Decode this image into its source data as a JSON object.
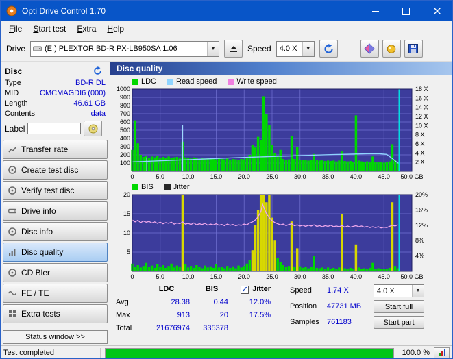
{
  "window": {
    "title": "Opti Drive Control 1.70"
  },
  "menu": {
    "items": [
      {
        "label": "File"
      },
      {
        "label": "Start test"
      },
      {
        "label": "Extra"
      },
      {
        "label": "Help"
      }
    ]
  },
  "toolbar": {
    "drive_label": "Drive",
    "drive_value": "(E:)   PLEXTOR BD-R  PX-LB950SA 1.06",
    "speed_label": "Speed",
    "speed_value": "4.0 X"
  },
  "sidebar": {
    "section_title": "Disc",
    "info": [
      {
        "label": "Type",
        "value": "BD-R DL"
      },
      {
        "label": "MID",
        "value": "CMCMAGDI6 (000)"
      },
      {
        "label": "Length",
        "value": "46.61 GB"
      },
      {
        "label": "Contents",
        "value": "data"
      }
    ],
    "label_label": "Label",
    "label_value": "",
    "buttons": [
      {
        "label": "Transfer rate"
      },
      {
        "label": "Create test disc"
      },
      {
        "label": "Verify test disc"
      },
      {
        "label": "Drive info"
      },
      {
        "label": "Disc info"
      },
      {
        "label": "Disc quality",
        "active": true
      },
      {
        "label": "CD Bler"
      },
      {
        "label": "FE / TE"
      },
      {
        "label": "Extra tests"
      }
    ],
    "status_window_button": "Status window >>"
  },
  "panel": {
    "title": "Disc quality",
    "stats": {
      "ldc_header": "LDC",
      "bis_header": "BIS",
      "jitter_label": "Jitter",
      "jitter_checked": true,
      "rows": [
        {
          "label": "Avg",
          "ldc": "28.38",
          "bis": "0.44",
          "jitter": "12.0%"
        },
        {
          "label": "Max",
          "ldc": "913",
          "bis": "20",
          "jitter": "17.5%"
        },
        {
          "label": "Total",
          "ldc": "21676974",
          "bis": "335378",
          "jitter": ""
        }
      ],
      "speed_label": "Speed",
      "speed_value": "1.74 X",
      "speed_select_value": "4.0 X",
      "position_label": "Position",
      "position_value": "47731 MB",
      "samples_label": "Samples",
      "samples_value": "761183",
      "start_full_label": "Start full",
      "start_part_label": "Start part"
    }
  },
  "statusbar": {
    "text": "Test completed",
    "progress_percent": 100,
    "progress_label": "100.0 %"
  },
  "chart_data": [
    {
      "id": "ldc-chart",
      "type": "bar+line",
      "title": "Disc quality scan - LDC with read/write speed",
      "legend": [
        {
          "label": "LDC",
          "color": "#00d800"
        },
        {
          "label": "Read speed",
          "color": "#8fd4ff"
        },
        {
          "label": "Write speed",
          "color": "#f080e0"
        }
      ],
      "bg": "#3c3c9c",
      "grid": "#7272d4",
      "x_range": [
        0,
        50
      ],
      "x_ticks": [
        {
          "v": 0,
          "label": "0"
        },
        {
          "v": 5,
          "label": "5.0"
        },
        {
          "v": 10,
          "label": "10.0"
        },
        {
          "v": 15,
          "label": "15.0"
        },
        {
          "v": 20,
          "label": "20.0"
        },
        {
          "v": 25,
          "label": "25.0"
        },
        {
          "v": 30,
          "label": "30.0"
        },
        {
          "v": 35,
          "label": "35.0"
        },
        {
          "v": 40,
          "label": "40.0"
        },
        {
          "v": 45,
          "label": "45.0"
        },
        {
          "v": 50,
          "label": "50.0 GB"
        }
      ],
      "left_axis": {
        "min": 0,
        "max": 1000,
        "ticks": [
          100,
          200,
          300,
          400,
          500,
          600,
          700,
          800,
          900,
          1000
        ]
      },
      "right_axis": {
        "min": 0,
        "max": 18,
        "ticks": [
          {
            "v": 2,
            "label": "2 X"
          },
          {
            "v": 4,
            "label": "4 X"
          },
          {
            "v": 6,
            "label": "6 X"
          },
          {
            "v": 8,
            "label": "8 X"
          },
          {
            "v": 10,
            "label": "10 X"
          },
          {
            "v": 12,
            "label": "12 X"
          },
          {
            "v": 14,
            "label": "14 X"
          },
          {
            "v": 16,
            "label": "16 X"
          },
          {
            "v": 18,
            "label": "18 X"
          }
        ]
      },
      "bars": {
        "x_start": 0,
        "x_step": 0.5,
        "color": "#00d800",
        "values": [
          260,
          620,
          340,
          200,
          175,
          190,
          165,
          180,
          170,
          185,
          160,
          175,
          165,
          180,
          160,
          170,
          175,
          160,
          360,
          170,
          165,
          155,
          170,
          160,
          150,
          165,
          155,
          160,
          150,
          160,
          145,
          155,
          150,
          145,
          155,
          140,
          150,
          145,
          140,
          150,
          145,
          160,
          200,
          320,
          290,
          420,
          380,
          913,
          700,
          560,
          320,
          220,
          180,
          260,
          150,
          140,
          145,
          430,
          150,
          300,
          140,
          135,
          140,
          130,
          140,
          210,
          135,
          130,
          135,
          125,
          130,
          125,
          130,
          120,
          130,
          240,
          125,
          120,
          125,
          115,
          680,
          130,
          120,
          115,
          120,
          110,
          180,
          115,
          110,
          115,
          105,
          110,
          120,
          330,
          140,
          110
        ]
      },
      "lines": [
        {
          "name": "read-speed",
          "color": "#8fd4ff",
          "axis": "right",
          "points": [
            [
              0,
              2.05
            ],
            [
              2,
              2.15
            ],
            [
              4,
              2.25
            ],
            [
              6,
              2.35
            ],
            [
              8,
              2.45
            ],
            [
              10,
              2.55
            ],
            [
              12,
              2.65
            ],
            [
              14,
              2.75
            ],
            [
              16,
              2.85
            ],
            [
              18,
              2.95
            ],
            [
              20,
              3.05
            ],
            [
              22,
              3.12
            ],
            [
              24,
              3.2
            ],
            [
              26,
              3.28
            ],
            [
              28,
              3.35
            ],
            [
              30,
              3.45
            ],
            [
              32,
              3.52
            ],
            [
              34,
              3.6
            ],
            [
              36,
              3.68
            ],
            [
              38,
              3.72
            ],
            [
              40,
              3.78
            ],
            [
              42,
              3.82
            ],
            [
              44,
              3.85
            ],
            [
              45.5,
              3.7
            ],
            [
              46.5,
              2.8
            ],
            [
              47.2,
              2.1
            ],
            [
              47.6,
              1.74
            ]
          ]
        }
      ],
      "markers": [
        {
          "x": 2.6,
          "frac": 0.17,
          "color": "#9fd8ff"
        },
        {
          "x": 9.0,
          "frac": 0.56,
          "color": "#9fd8ff"
        },
        {
          "x": 47.7,
          "frac": 1,
          "color": "#00e8e8"
        }
      ]
    },
    {
      "id": "bis-chart",
      "type": "bar+line",
      "title": "Disc quality scan - BIS with jitter",
      "legend": [
        {
          "label": "BIS",
          "color": "#00d800"
        },
        {
          "label": "Jitter",
          "color": "#282828"
        }
      ],
      "bg": "#3c3c9c",
      "grid": "#7272d4",
      "x_range": [
        0,
        50
      ],
      "x_ticks": [
        {
          "v": 0,
          "label": "0"
        },
        {
          "v": 5,
          "label": "5.0"
        },
        {
          "v": 10,
          "label": "10.0"
        },
        {
          "v": 15,
          "label": "15.0"
        },
        {
          "v": 20,
          "label": "20.0"
        },
        {
          "v": 25,
          "label": "25.0"
        },
        {
          "v": 30,
          "label": "30.0"
        },
        {
          "v": 35,
          "label": "35.0"
        },
        {
          "v": 40,
          "label": "40.0"
        },
        {
          "v": 45,
          "label": "45.0"
        },
        {
          "v": 50,
          "label": "50.0 GB"
        }
      ],
      "left_axis": {
        "min": 0,
        "max": 20,
        "ticks": [
          5,
          10,
          15,
          20
        ]
      },
      "right_axis": {
        "min": 0,
        "max": 20,
        "ticks": [
          {
            "v": 4,
            "label": "4%"
          },
          {
            "v": 8,
            "label": "8%"
          },
          {
            "v": 12,
            "label": "12%"
          },
          {
            "v": 16,
            "label": "16%"
          },
          {
            "v": 20,
            "label": "20%"
          }
        ]
      },
      "bars": {
        "x_start": 0,
        "x_step": 0.5,
        "color": "#00d800",
        "highlight": {
          "min": 5,
          "color": "#d8d800"
        },
        "values": [
          2.0,
          1.2,
          1.6,
          1.0,
          1.4,
          2.2,
          1.1,
          1.5,
          0.9,
          1.8,
          1.2,
          1.6,
          0.9,
          1.4,
          2.0,
          1.0,
          1.5,
          1.1,
          20,
          1.8,
          1.0,
          1.4,
          0.9,
          1.6,
          1.1,
          0.8,
          1.5,
          1.0,
          1.3,
          0.9,
          1.8,
          1.0,
          1.2,
          0.8,
          1.4,
          0.9,
          1.3,
          0.8,
          1.5,
          1.0,
          1.4,
          2.0,
          3.0,
          5.5,
          12,
          16,
          20,
          20,
          18,
          20,
          14,
          8,
          3.5,
          2.5,
          1.6,
          1.2,
          1.4,
          13,
          1.2,
          6,
          1.3,
          0.9,
          1.2,
          0.8,
          1.1,
          4,
          0.9,
          0.8,
          1.0,
          0.7,
          1.0,
          0.7,
          0.9,
          0.7,
          1.0,
          15,
          0.8,
          0.7,
          0.9,
          0.6,
          7,
          1.0,
          0.7,
          0.8,
          0.6,
          0.9,
          2.2,
          0.7,
          0.8,
          0.6,
          0.7,
          0.6,
          0.9,
          18,
          1.4,
          0.8
        ]
      },
      "lines": [
        {
          "name": "jitter",
          "color": "#f0a8ec",
          "axis": "right",
          "points": [
            [
              0,
              13.4
            ],
            [
              0.5,
              12.9
            ],
            [
              1,
              13.3
            ],
            [
              1.5,
              12.7
            ],
            [
              2,
              13.1
            ],
            [
              2.5,
              12.8
            ],
            [
              3,
              13.0
            ],
            [
              3.5,
              12.6
            ],
            [
              4,
              12.9
            ],
            [
              4.5,
              12.5
            ],
            [
              5,
              12.8
            ],
            [
              5.5,
              12.4
            ],
            [
              6,
              12.7
            ],
            [
              6.5,
              12.5
            ],
            [
              7,
              12.8
            ],
            [
              7.5,
              12.3
            ],
            [
              8,
              12.6
            ],
            [
              8.5,
              12.4
            ],
            [
              9,
              12.9
            ],
            [
              9.5,
              12.3
            ],
            [
              10,
              12.5
            ],
            [
              10.5,
              12.2
            ],
            [
              11,
              12.6
            ],
            [
              11.5,
              12.1
            ],
            [
              12,
              12.4
            ],
            [
              12.5,
              12.2
            ],
            [
              13,
              12.5
            ],
            [
              13.5,
              12.0
            ],
            [
              14,
              12.3
            ],
            [
              14.5,
              12.1
            ],
            [
              15,
              12.4
            ],
            [
              15.5,
              12.0
            ],
            [
              16,
              12.2
            ],
            [
              16.5,
              11.9
            ],
            [
              17,
              12.3
            ],
            [
              17.5,
              12.0
            ],
            [
              18,
              12.2
            ],
            [
              18.5,
              11.9
            ],
            [
              19,
              12.1
            ],
            [
              19.5,
              12.0
            ],
            [
              20,
              12.3
            ],
            [
              20.5,
              12.1
            ],
            [
              21,
              12.6
            ],
            [
              21.5,
              12.9
            ],
            [
              22,
              13.4
            ],
            [
              22.5,
              14.2
            ],
            [
              23,
              15.6
            ],
            [
              23.3,
              17.5
            ],
            [
              23.6,
              16.4
            ],
            [
              24,
              15.0
            ],
            [
              24.5,
              14.0
            ],
            [
              25,
              13.2
            ],
            [
              25.5,
              12.7
            ],
            [
              26,
              12.4
            ],
            [
              26.5,
              12.1
            ],
            [
              27,
              12.3
            ],
            [
              27.5,
              11.9
            ],
            [
              28,
              12.2
            ],
            [
              28.5,
              12.4
            ],
            [
              29,
              11.9
            ],
            [
              29.5,
              12.1
            ],
            [
              30,
              11.8
            ],
            [
              30.5,
              12.0
            ],
            [
              31,
              11.7
            ],
            [
              31.5,
              12.0
            ],
            [
              32,
              11.8
            ],
            [
              32.5,
              12.1
            ],
            [
              33,
              11.7
            ],
            [
              33.5,
              11.9
            ],
            [
              34,
              11.6
            ],
            [
              34.5,
              11.9
            ],
            [
              35,
              11.7
            ],
            [
              35.5,
              12.0
            ],
            [
              36,
              11.6
            ],
            [
              36.5,
              11.8
            ],
            [
              37,
              11.6
            ],
            [
              37.5,
              11.9
            ],
            [
              38,
              11.5
            ],
            [
              38.5,
              11.8
            ],
            [
              39,
              11.5
            ],
            [
              39.5,
              11.7
            ],
            [
              40,
              11.9
            ],
            [
              40.5,
              11.6
            ],
            [
              41,
              11.8
            ],
            [
              41.5,
              11.5
            ],
            [
              42,
              11.7
            ],
            [
              42.5,
              11.4
            ],
            [
              43,
              11.6
            ],
            [
              43.5,
              11.4
            ],
            [
              44,
              11.6
            ],
            [
              44.5,
              11.3
            ],
            [
              45,
              11.5
            ],
            [
              45.5,
              11.4
            ],
            [
              46,
              11.7
            ],
            [
              46.5,
              12.0
            ],
            [
              47,
              11.8
            ],
            [
              47.5,
              12.1
            ]
          ]
        }
      ],
      "markers": [
        {
          "x": 47.7,
          "frac": 1,
          "color": "#00e8e8"
        }
      ]
    }
  ]
}
